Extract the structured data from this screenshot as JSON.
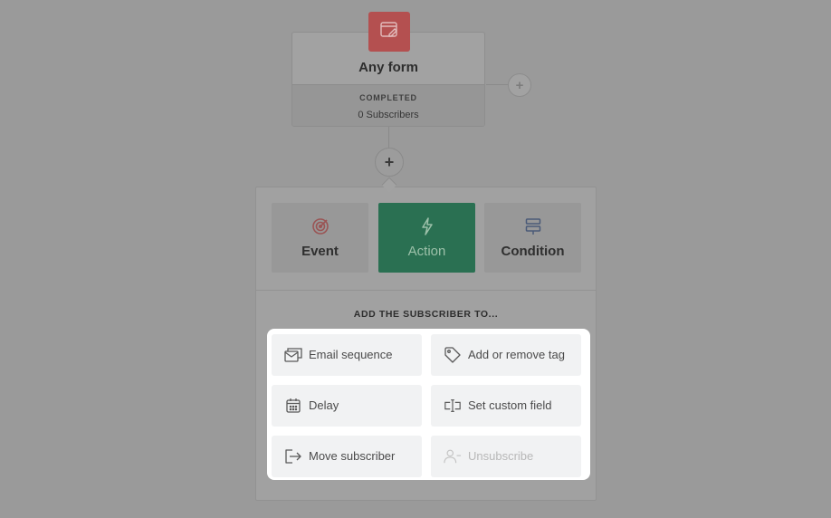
{
  "trigger": {
    "title": "Any form",
    "status": "COMPLETED",
    "subscribers": "0 Subscribers",
    "badge_icon": "form-edit-icon",
    "badge_color": "#b45050"
  },
  "add_buttons": {
    "side_symbol": "+",
    "main_symbol": "+"
  },
  "tabs": [
    {
      "id": "event",
      "label": "Event",
      "icon": "target-icon",
      "active": false
    },
    {
      "id": "action",
      "label": "Action",
      "icon": "lightning-icon",
      "active": true
    },
    {
      "id": "condition",
      "label": "Condition",
      "icon": "condition-icon",
      "active": false
    }
  ],
  "section_heading": "ADD THE SUBSCRIBER TO...",
  "options": [
    {
      "id": "email-sequence",
      "label": "Email sequence",
      "icon": "email-sequence-icon",
      "enabled": true
    },
    {
      "id": "add-remove-tag",
      "label": "Add or remove tag",
      "icon": "tag-icon",
      "enabled": true
    },
    {
      "id": "delay",
      "label": "Delay",
      "icon": "calendar-icon",
      "enabled": true
    },
    {
      "id": "set-custom-field",
      "label": "Set custom field",
      "icon": "custom-field-icon",
      "enabled": true
    },
    {
      "id": "move-subscriber",
      "label": "Move subscriber",
      "icon": "move-exit-icon",
      "enabled": true
    },
    {
      "id": "unsubscribe",
      "label": "Unsubscribe",
      "icon": "user-minus-icon",
      "enabled": false
    }
  ],
  "colors": {
    "overlay": "#9a9a9a",
    "action_active": "#2a7052",
    "highlight": "#ffffff"
  }
}
